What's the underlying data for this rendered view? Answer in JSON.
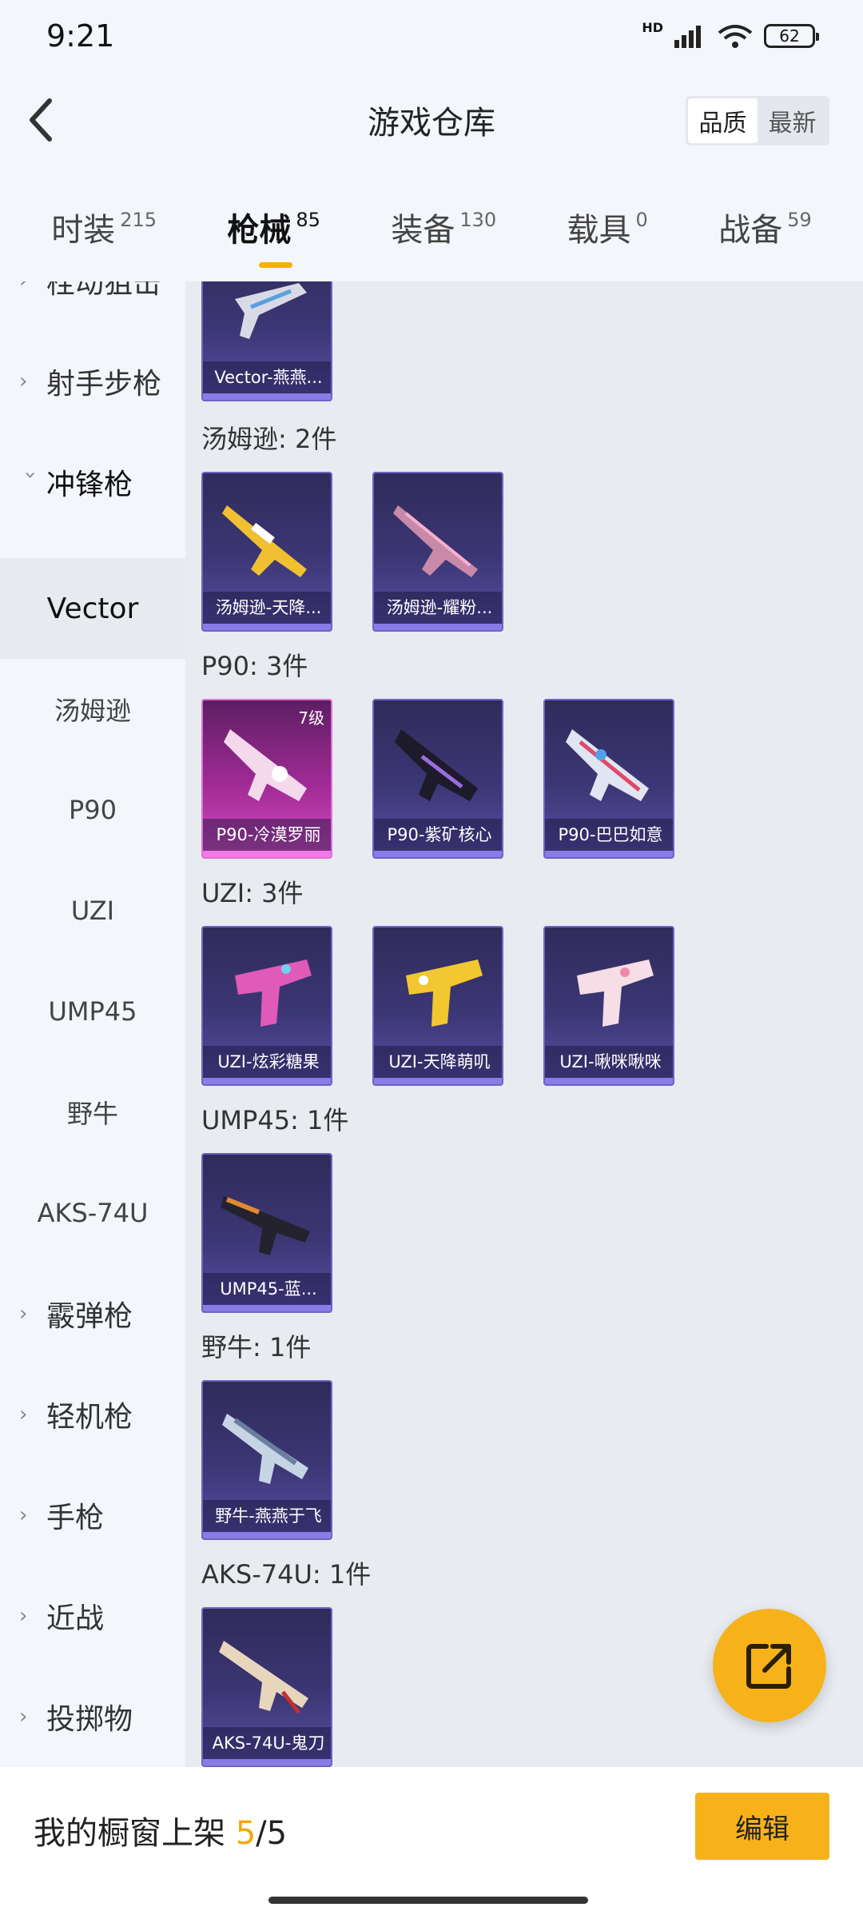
{
  "status_bar": {
    "time": "9:21",
    "network": "HD",
    "battery": "62"
  },
  "header": {
    "title": "游戏仓库",
    "back_icon": "chevron-left-icon",
    "sort_options": [
      "品质",
      "最新"
    ],
    "sort_selected": "品质"
  },
  "tabs": [
    {
      "label": "时装",
      "count": "215"
    },
    {
      "label": "枪械",
      "count": "85",
      "active": true
    },
    {
      "label": "装备",
      "count": "130"
    },
    {
      "label": "载具",
      "count": "0"
    },
    {
      "label": "战备",
      "count": "59"
    }
  ],
  "sidebar": {
    "items": [
      {
        "label": "栓动狙击",
        "type": "group",
        "expanded": false
      },
      {
        "label": "射手步枪",
        "type": "group",
        "expanded": false
      },
      {
        "label": "冲锋枪",
        "type": "group",
        "expanded": true
      },
      {
        "label": "Vector",
        "type": "sub",
        "selected": true
      },
      {
        "label": "汤姆逊",
        "type": "sub"
      },
      {
        "label": "P90",
        "type": "sub"
      },
      {
        "label": "UZI",
        "type": "sub"
      },
      {
        "label": "UMP45",
        "type": "sub"
      },
      {
        "label": "野牛",
        "type": "sub"
      },
      {
        "label": "AKS-74U",
        "type": "sub"
      },
      {
        "label": "霰弹枪",
        "type": "group",
        "expanded": false
      },
      {
        "label": "轻机枪",
        "type": "group",
        "expanded": false
      },
      {
        "label": "手枪",
        "type": "group",
        "expanded": false
      },
      {
        "label": "近战",
        "type": "group",
        "expanded": false
      },
      {
        "label": "投掷物",
        "type": "group",
        "expanded": false
      }
    ]
  },
  "content": {
    "sections": [
      {
        "title": "",
        "items": [
          {
            "name": "Vector-燕燕..."
          }
        ]
      },
      {
        "title": "汤姆逊: 2件",
        "items": [
          {
            "name": "汤姆逊-天降..."
          },
          {
            "name": "汤姆逊-耀粉..."
          }
        ]
      },
      {
        "title": "P90: 3件",
        "items": [
          {
            "name": "P90-冷漠罗丽",
            "level": "7级",
            "rarity": "pink"
          },
          {
            "name": "P90-紫矿核心"
          },
          {
            "name": "P90-巴巴如意"
          }
        ]
      },
      {
        "title": "UZI: 3件",
        "items": [
          {
            "name": "UZI-炫彩糖果"
          },
          {
            "name": "UZI-天降萌叽"
          },
          {
            "name": "UZI-啾咪啾咪"
          }
        ]
      },
      {
        "title": "UMP45: 1件",
        "items": [
          {
            "name": "UMP45-蓝..."
          }
        ]
      },
      {
        "title": "野牛: 1件",
        "items": [
          {
            "name": "野牛-燕燕于飞"
          }
        ]
      },
      {
        "title": "AKS-74U: 1件",
        "items": [
          {
            "name": "AKS-74U-鬼刀"
          }
        ]
      }
    ]
  },
  "fab_icon": "share-external-icon",
  "bottom_bar": {
    "label": "我的橱窗上架",
    "current": "5",
    "total": "/5",
    "edit_label": "编辑"
  },
  "colors": {
    "accent": "#f7b21a",
    "card_purple": "#3c3775",
    "card_pink": "#a22b96"
  }
}
